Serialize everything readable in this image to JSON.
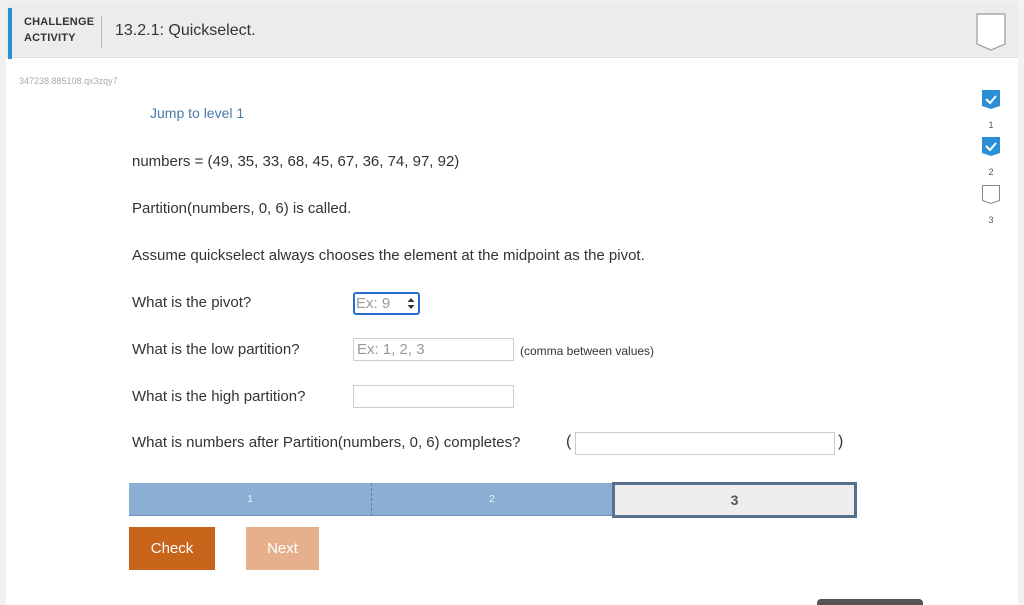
{
  "header": {
    "activity_type_line1": "CHALLENGE",
    "activity_type_line2": "ACTIVITY",
    "title": "13.2.1: Quickselect.",
    "bookmark_icon": "bookmark-outline-icon"
  },
  "activity_id": "347238.885108.qx3zqy7",
  "jump_link": "Jump to level 1",
  "prompt": {
    "numbers_line": "numbers = (49, 35, 33, 68, 45, 67, 36, 74, 97, 92)",
    "call_line": "Partition(numbers, 0, 6) is called.",
    "assumption_line": "Assume quickselect always chooses the element at the midpoint as the pivot."
  },
  "questions": {
    "pivot": {
      "label": "What is the pivot?",
      "value": "",
      "placeholder": "Ex: 9"
    },
    "low": {
      "label": "What is the low partition?",
      "value": "",
      "placeholder": "Ex: 1, 2, 3",
      "hint": "(comma between values)"
    },
    "high": {
      "label": "What is the high partition?",
      "value": "",
      "placeholder": ""
    },
    "after": {
      "label": "What is numbers after Partition(numbers, 0, 6) completes?",
      "open_paren": "(",
      "close_paren": ")",
      "value": "",
      "placeholder": ""
    }
  },
  "levels": [
    {
      "label": "1",
      "status": "completed"
    },
    {
      "label": "2",
      "status": "completed"
    },
    {
      "label": "3",
      "status": "current"
    }
  ],
  "buttons": {
    "check": "Check",
    "next": "Next"
  },
  "side_progress": [
    {
      "label": "1",
      "icon": "checked-bookmark-icon",
      "done": true
    },
    {
      "label": "2",
      "icon": "checked-bookmark-icon",
      "done": true
    },
    {
      "label": "3",
      "icon": "empty-bookmark-icon",
      "done": false
    }
  ],
  "colors": {
    "accent_blue": "#2a8fd6",
    "check_button": "#c9641b",
    "next_button_disabled": "#e6b08c",
    "level_completed": "#8aafd3",
    "level_current_border": "#58708f"
  }
}
